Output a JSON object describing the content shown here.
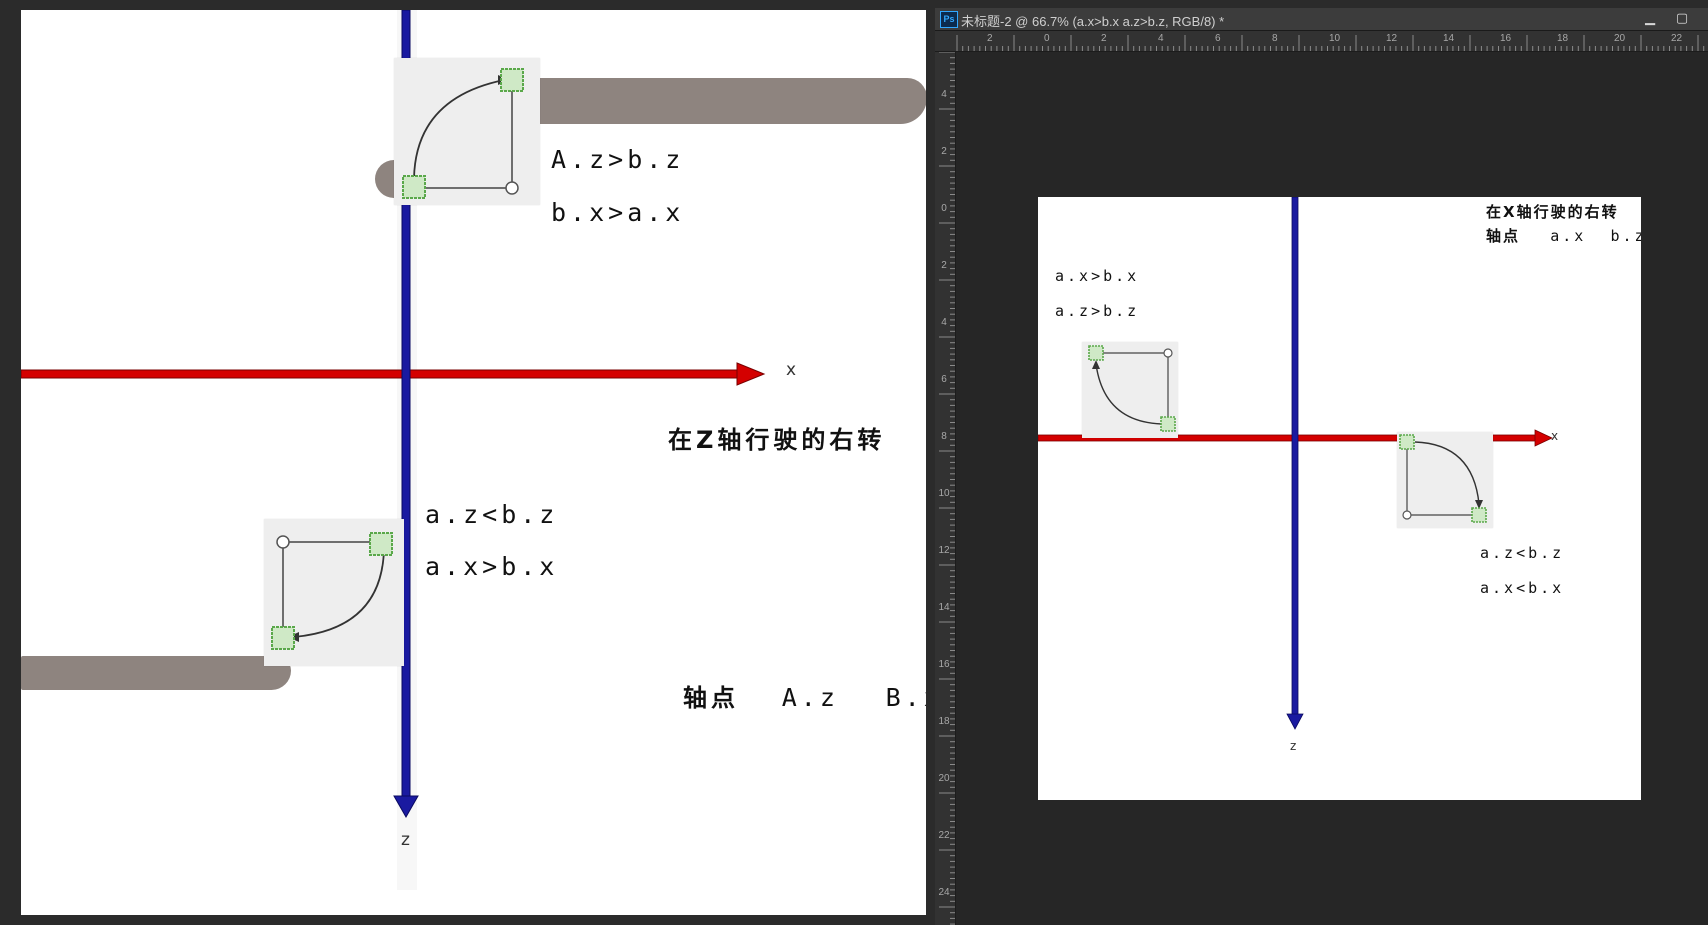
{
  "left_canvas": {
    "axis_x_label": "x",
    "axis_z_label": "z",
    "top_pair": {
      "line1": "A.z>b.z",
      "line2": "b.x>a.x"
    },
    "bottom_pair": {
      "line1": "a.z<b.z",
      "line2": "a.x>b.x"
    },
    "caption": "在Z轴行驶的右转",
    "pivot": {
      "label": "轴点",
      "v1": "A.z",
      "v2": "B.x"
    }
  },
  "ps_window": {
    "icon_label": "Ps",
    "title": "未标题-2 @ 66.7% (a.x>b.x a.z>b.z, RGB/8) *",
    "minimize_glyph": "▁",
    "restore_glyph": "▢",
    "ruler_top_marks": [
      "2",
      "0",
      "2",
      "4",
      "6",
      "8",
      "10",
      "12",
      "14",
      "16",
      "18",
      "20",
      "22"
    ],
    "ruler_left_marks": [
      "4",
      "2",
      "0",
      "2",
      "4",
      "6",
      "8",
      "10",
      "12",
      "14",
      "16",
      "18",
      "20",
      "22",
      "24"
    ],
    "doc": {
      "caption_line1": "在X轴行驶的右转",
      "pivot": {
        "label": "轴点",
        "v1": "a.x",
        "v2": "b.z"
      },
      "top_pair": {
        "line1": "a.x>b.x",
        "line2": "a.z>b.z"
      },
      "bottom_pair": {
        "line1": "a.z<b.z",
        "line2": "a.x<b.x"
      },
      "axis_x_label": "x",
      "axis_z_label": "z"
    }
  },
  "colors": {
    "x_axis": "#d40000",
    "z_axis": "#1a1aa0",
    "smear": "#8e847f",
    "thumb_bg": "#eeeeee",
    "node_green": "#5aa84a"
  },
  "icons": [
    "node-start-icon",
    "node-end-icon",
    "corner-circle-icon",
    "curve-arrow-icon"
  ]
}
